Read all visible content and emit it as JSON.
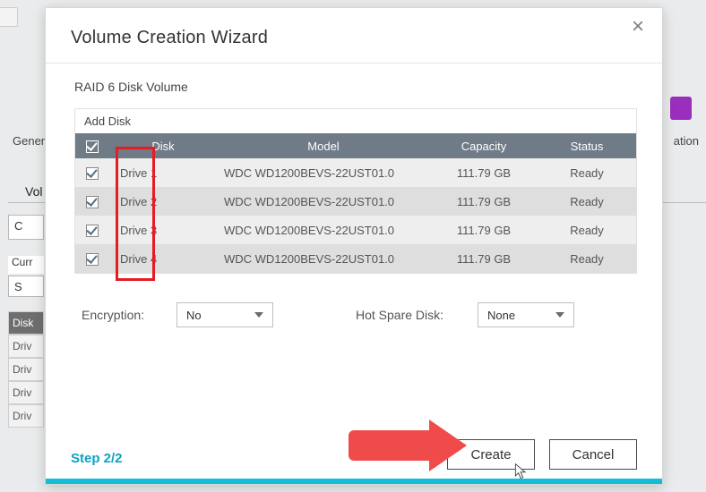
{
  "modal": {
    "title": "Volume Creation Wizard",
    "subtitle": "RAID 6 Disk Volume",
    "add_disk_label": "Add Disk",
    "headers": {
      "disk": "Disk",
      "model": "Model",
      "capacity": "Capacity",
      "status": "Status"
    },
    "rows": [
      {
        "disk": "Drive 1",
        "model": "WDC WD1200BEVS-22UST01.0",
        "capacity": "111.79 GB",
        "status": "Ready"
      },
      {
        "disk": "Drive 2",
        "model": "WDC WD1200BEVS-22UST01.0",
        "capacity": "111.79 GB",
        "status": "Ready"
      },
      {
        "disk": "Drive 3",
        "model": "WDC WD1200BEVS-22UST01.0",
        "capacity": "111.79 GB",
        "status": "Ready"
      },
      {
        "disk": "Drive 4",
        "model": "WDC WD1200BEVS-22UST01.0",
        "capacity": "111.79 GB",
        "status": "Ready"
      }
    ],
    "options": {
      "encryption_label": "Encryption:",
      "encryption_value": "No",
      "hotspare_label": "Hot Spare Disk:",
      "hotspare_value": "None"
    },
    "step": "Step 2/2",
    "create_label": "Create",
    "cancel_label": "Cancel"
  },
  "bg": {
    "left1": "Genera",
    "right1": "ation",
    "tab": "Vol",
    "box1": "C",
    "curr": "Curr",
    "s": "S",
    "disk": "Disk",
    "drv": "Driv"
  }
}
